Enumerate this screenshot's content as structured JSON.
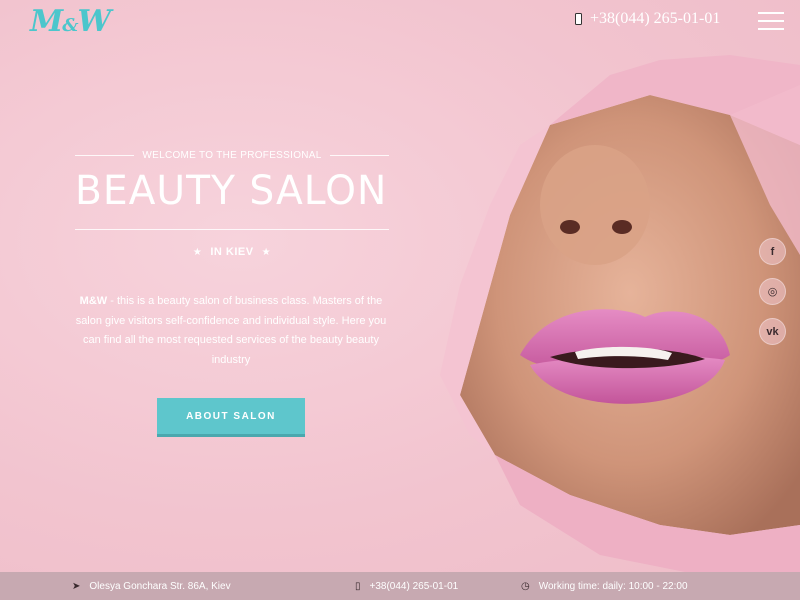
{
  "header": {
    "logo_main": "M",
    "logo_amp": "&",
    "logo_end": "W",
    "phone": "+38(044) 265-01-01"
  },
  "hero": {
    "welcome": "WELCOME TO THE PROFESSIONAL",
    "title": "BEAUTY SALON",
    "city": "IN KIEV",
    "desc_brand": "M&W",
    "desc_text": " - this is a beauty salon of business class. Masters of the salon give visitors self-confidence and individual style. Here you can find all the most requested services of the beauty beauty industry",
    "cta_label": "ABOUT SALON"
  },
  "social": {
    "facebook": "f",
    "instagram": "◎",
    "vk": "vk"
  },
  "footer": {
    "address": "Olesya Gonchara Str. 86A, Kiev",
    "phone": "+38(044) 265-01-01",
    "hours": "Working time: daily: 10:00 - 22:00"
  },
  "colors": {
    "accent": "#5ec6cc",
    "background": "#f3c9d2",
    "footer": "#c7a9b1",
    "lips": "#d868a8"
  },
  "icons": [
    "phone-icon",
    "menu-icon",
    "star-icon",
    "facebook-icon",
    "instagram-icon",
    "vk-icon",
    "location-icon",
    "clock-icon"
  ]
}
